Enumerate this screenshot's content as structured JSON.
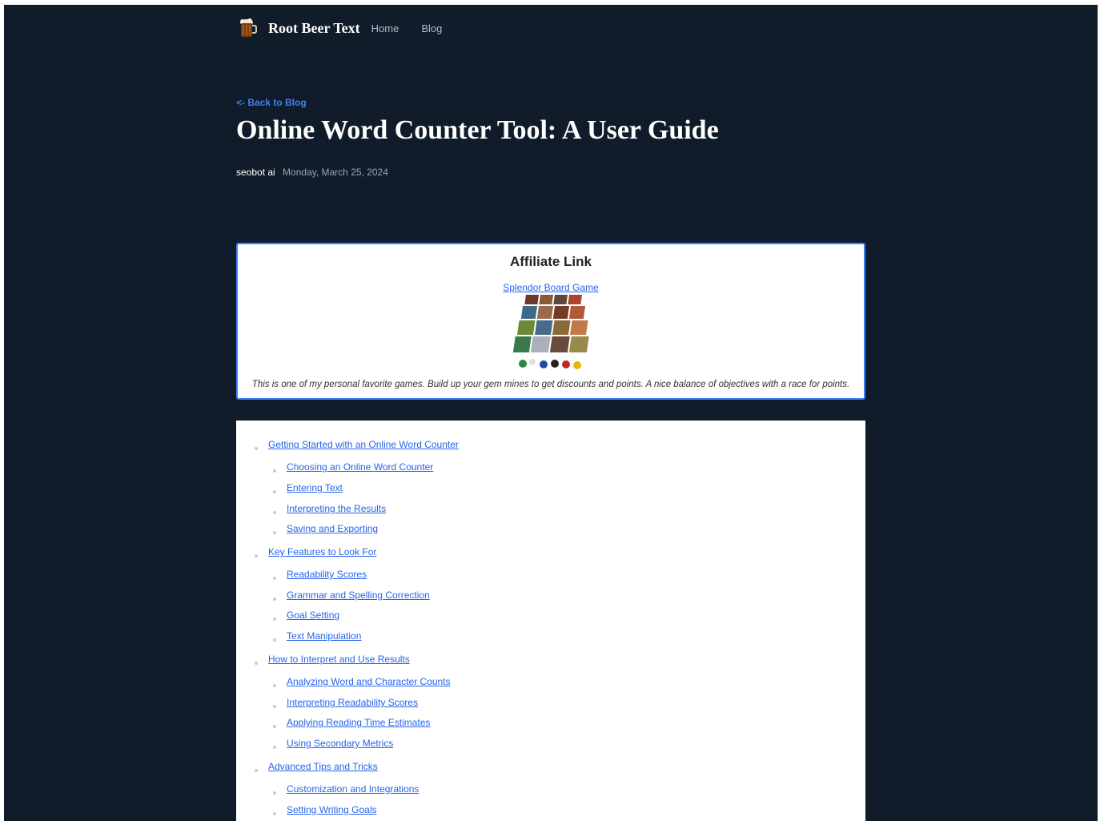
{
  "header": {
    "brand": "Root Beer Text",
    "nav": [
      "Home",
      "Blog"
    ]
  },
  "article": {
    "back_link": "<- Back to Blog",
    "title": "Online Word Counter Tool: A User Guide",
    "author": "seobot ai",
    "date": "Monday, March 25, 2024"
  },
  "affiliate": {
    "heading": "Affiliate Link",
    "link_text": "Splendor Board Game",
    "description": "This is one of my personal favorite games. Build up your gem mines to get discounts and points. A nice balance of objectives with a race for points."
  },
  "toc": [
    {
      "label": "Getting Started with an Online Word Counter",
      "children": [
        "Choosing an Online Word Counter",
        "Entering Text",
        "Interpreting the Results",
        "Saving and Exporting"
      ]
    },
    {
      "label": "Key Features to Look For",
      "children": [
        "Readability Scores",
        "Grammar and Spelling Correction",
        "Goal Setting",
        "Text Manipulation"
      ]
    },
    {
      "label": "How to Interpret and Use Results",
      "children": [
        "Analyzing Word and Character Counts",
        "Interpreting Readability Scores",
        "Applying Reading Time Estimates",
        "Using Secondary Metrics"
      ]
    },
    {
      "label": "Advanced Tips and Tricks",
      "children": [
        "Customization and Integrations",
        "Setting Writing Goals"
      ]
    }
  ],
  "colors": {
    "background": "#111c2b",
    "accent": "#3b82f6",
    "link": "#2563eb"
  },
  "icons": {
    "logo": "root-beer-mug-icon"
  }
}
